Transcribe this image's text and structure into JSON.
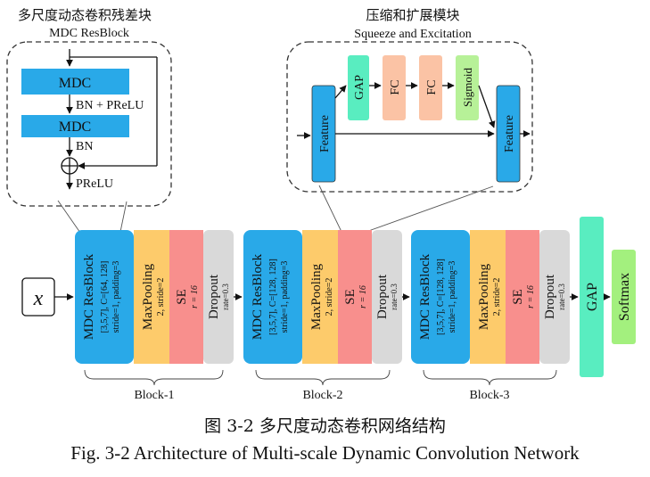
{
  "mdc_panel": {
    "title_cn": "多尺度动态卷积残差块",
    "title_en": "MDC ResBlock",
    "block1": "MDC",
    "block2": "MDC",
    "label_bn_prelu": "BN + PReLU",
    "label_bn": "BN",
    "label_prelu": "PReLU",
    "sum_symbol": "⊕"
  },
  "se_panel": {
    "title_cn": "压缩和扩展模块",
    "title_en": "Squeeze and Excitation",
    "feature_in": "Feature",
    "gap": "GAP",
    "fc1": "FC",
    "fc2": "FC",
    "sigmoid": "Sigmoid",
    "feature_out": "Feature"
  },
  "input_symbol": "x",
  "blocks": [
    {
      "mdc_title": "MDC ResBlock",
      "mdc_params1": "[3,5,7], C=[64, 128]",
      "mdc_params2": "stride=1, padding=3",
      "pool_title": "MaxPooling",
      "pool_params": "2, stride=2",
      "se_title": "SE",
      "se_params": "r = 16",
      "drop_title": "Dropout",
      "drop_params": "rate=0.3",
      "label": "Block-1"
    },
    {
      "mdc_title": "MDC ResBlock",
      "mdc_params1": "[3,5,7], C=[128, 128]",
      "mdc_params2": "stride=1, padding=3",
      "pool_title": "MaxPooling",
      "pool_params": "2, stride=2",
      "se_title": "SE",
      "se_params": "r = 16",
      "drop_title": "Dropout",
      "drop_params": "rate=0.3",
      "label": "Block-2"
    },
    {
      "mdc_title": "MDC ResBlock",
      "mdc_params1": "[3,5,7], C=[128, 128]",
      "mdc_params2": "stride=1, padding=3",
      "pool_title": "MaxPooling",
      "pool_params": "2, stride=2",
      "se_title": "SE",
      "se_params": "r = 16",
      "drop_title": "Dropout",
      "drop_params": "rate=0.3",
      "label": "Block-3"
    }
  ],
  "gap_label": "GAP",
  "softmax_label": "Softmax",
  "caption_cn": "图 3-2  多尺度动态卷积网络结构",
  "caption_en": "Fig. 3-2 Architecture of Multi-scale Dynamic Convolution Network",
  "colors": {
    "blue": "#29a9e8",
    "orange": "#fdcb6b",
    "red": "#f88f8d",
    "gray": "#d9d9d9",
    "teal": "#59edc0",
    "green": "#a3f07e",
    "salmon": "#fbc3a5",
    "lime": "#b7f198"
  }
}
